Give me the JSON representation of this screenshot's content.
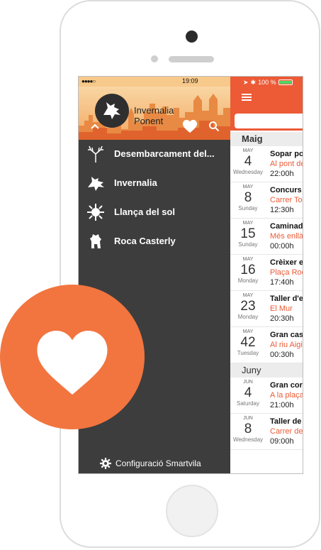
{
  "status": {
    "carrier_dots": "●●●●○",
    "time": "19:09",
    "battery_label": "100 %"
  },
  "app": {
    "name": "Invernalia Ponent"
  },
  "menu": {
    "items": [
      {
        "label": "Desembarcament del..."
      },
      {
        "label": "Invernalia"
      },
      {
        "label": "Llança del sol"
      },
      {
        "label": "Roca Casterly"
      }
    ],
    "settings_label": "Configuració Smartvila"
  },
  "events": {
    "month1": "Maig",
    "month2": "Juny",
    "items": [
      {
        "month": "MAY",
        "day": "4",
        "dow": "Wednesday",
        "title": "Sopar po",
        "place": "Al pont de",
        "time": "22:00h"
      },
      {
        "month": "MAY",
        "day": "8",
        "dow": "Sunday",
        "title": "Concurs",
        "place": "Carrer To",
        "time": "12:30h"
      },
      {
        "month": "MAY",
        "day": "15",
        "dow": "Sunday",
        "title": "Caminad",
        "place": "Més enllà",
        "time": "00:00h"
      },
      {
        "month": "MAY",
        "day": "16",
        "dow": "Monday",
        "title": "Crèixer e",
        "place": "Plaça Roc",
        "time": "17:40h"
      },
      {
        "month": "MAY",
        "day": "23",
        "dow": "Monday",
        "title": "Taller d'e",
        "place": "El Mur",
        "time": "20:30h"
      },
      {
        "month": "MAY",
        "day": "42",
        "dow": "Tuesday",
        "title": "Gran cas",
        "place": "Al riu Aigi",
        "time": "00:30h"
      },
      {
        "month": "JUN",
        "day": "4",
        "dow": "Saturday",
        "title": "Gran cor",
        "place": "A la plaça",
        "time": "21:00h"
      },
      {
        "month": "JUN",
        "day": "8",
        "dow": "Wednesday",
        "title": "Taller de",
        "place": "Carrer de",
        "time": "09:00h"
      }
    ]
  },
  "colors": {
    "accent": "#ec5a36",
    "badge": "#f2753f",
    "drawer": "#3d3d3d"
  },
  "icons": {
    "badge": "heart-icon"
  }
}
